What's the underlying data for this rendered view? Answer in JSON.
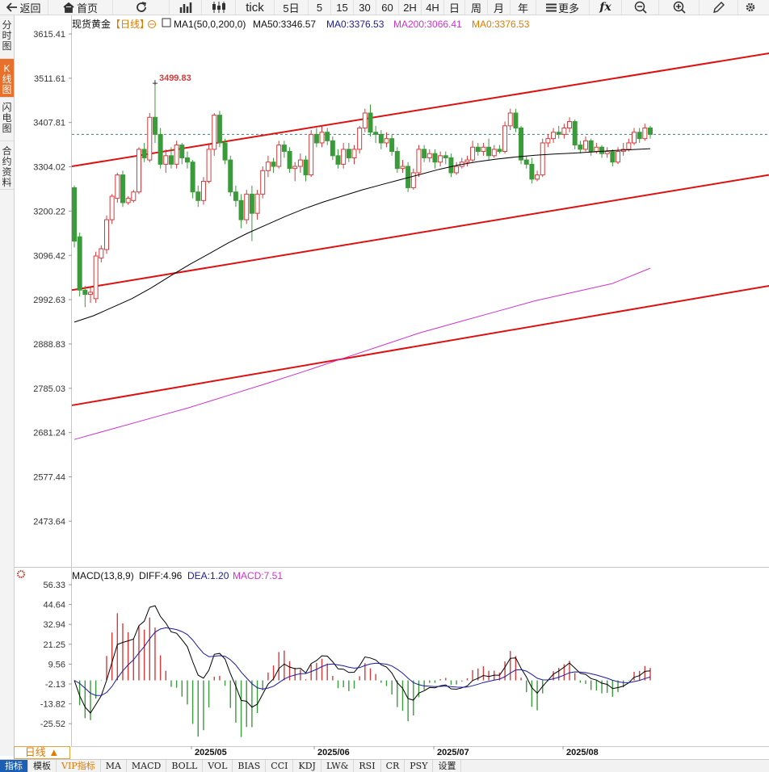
{
  "toolbar": {
    "back": "返回",
    "home": "首页",
    "tick": "tick",
    "periods": [
      "5日",
      "5",
      "15",
      "30",
      "60",
      "2H",
      "4H",
      "日",
      "周",
      "月",
      "年"
    ],
    "more": "更多"
  },
  "left_tabs": [
    {
      "label": "分时图",
      "active": false
    },
    {
      "label": "K线图",
      "active": true
    },
    {
      "label": "闪电图",
      "active": false
    },
    {
      "label": "合约资料",
      "active": false
    }
  ],
  "header": {
    "instrument": "现货黄金",
    "period": "【日线】",
    "ma1": "MA1(50,0,200,0)",
    "ma50": "MA50:3346.57",
    "ma0": "MA0:3376.53",
    "ma200": "MA200:3066.41",
    "ma0b": "MA0:3376.53"
  },
  "price_axis": [
    "3615.41",
    "3511.61",
    "3407.81",
    "3304.02",
    "3200.22",
    "3096.42",
    "2992.63",
    "2888.83",
    "2785.03",
    "2681.24",
    "2577.44",
    "2473.64"
  ],
  "high_label": "3499.83",
  "macd_header": {
    "name": "MACD(13,8,9)",
    "diff": "DIFF:4.96",
    "dea": "DEA:1.20",
    "macd": "MACD:7.51"
  },
  "macd_axis": [
    "56.33",
    "44.64",
    "32.94",
    "21.25",
    "9.56",
    "-2.13",
    "-13.82",
    "-25.52"
  ],
  "date_axis": [
    "2025/05",
    "2025/06",
    "2025/07",
    "2025/08"
  ],
  "period_tab": "日线 ▲",
  "bottom_tabs": [
    {
      "label": "指标",
      "active": true
    },
    {
      "label": "模板",
      "active": false
    },
    {
      "label": "VIP指标",
      "vip": true
    },
    {
      "label": "MA"
    },
    {
      "label": "MACD"
    },
    {
      "label": "BOLL"
    },
    {
      "label": "VOL"
    },
    {
      "label": "BIAS"
    },
    {
      "label": "CCI"
    },
    {
      "label": "KDJ"
    },
    {
      "label": "LW&"
    },
    {
      "label": "RSI"
    },
    {
      "label": "CR"
    },
    {
      "label": "PSY"
    },
    {
      "label": "设置"
    }
  ],
  "colors": {
    "up": "#d83a3a",
    "down": "#3a9b3a",
    "ma50": "#000000",
    "ma200": "#cc33cc",
    "channel": "#dd1111",
    "dea": "#1a1aa0"
  },
  "chart_data": {
    "type": "candlestick",
    "title": "现货黄金 日线",
    "ylim": [
      2420,
      3650
    ],
    "candles": [
      [
        3255,
        3130,
        3260,
        3115
      ],
      [
        3140,
        3015,
        3150,
        3000
      ],
      [
        3015,
        3005,
        3025,
        2975
      ],
      [
        3005,
        3010,
        3020,
        2985
      ],
      [
        2995,
        3095,
        3105,
        2985
      ],
      [
        3090,
        3112,
        3120,
        3080
      ],
      [
        3110,
        3180,
        3190,
        3100
      ],
      [
        3180,
        3235,
        3240,
        3170
      ],
      [
        3230,
        3285,
        3290,
        3220
      ],
      [
        3285,
        3220,
        3295,
        3210
      ],
      [
        3220,
        3230,
        3235,
        3215
      ],
      [
        3225,
        3245,
        3250,
        3220
      ],
      [
        3245,
        3345,
        3350,
        3240
      ],
      [
        3345,
        3325,
        3360,
        3315
      ],
      [
        3320,
        3420,
        3430,
        3315
      ],
      [
        3420,
        3380,
        3499.83,
        3360
      ],
      [
        3380,
        3310,
        3395,
        3300
      ],
      [
        3310,
        3330,
        3345,
        3290
      ],
      [
        3330,
        3310,
        3350,
        3300
      ],
      [
        3310,
        3355,
        3365,
        3300
      ],
      [
        3355,
        3325,
        3360,
        3310
      ],
      [
        3325,
        3315,
        3340,
        3300
      ],
      [
        3315,
        3245,
        3320,
        3230
      ],
      [
        3245,
        3225,
        3260,
        3210
      ],
      [
        3225,
        3270,
        3280,
        3215
      ],
      [
        3270,
        3345,
        3355,
        3265
      ],
      [
        3345,
        3425,
        3430,
        3330
      ],
      [
        3425,
        3360,
        3435,
        3350
      ],
      [
        3360,
        3320,
        3370,
        3310
      ],
      [
        3320,
        3245,
        3330,
        3235
      ],
      [
        3245,
        3225,
        3260,
        3210
      ],
      [
        3225,
        3180,
        3240,
        3160
      ],
      [
        3180,
        3240,
        3250,
        3170
      ],
      [
        3240,
        3195,
        3260,
        3130
      ],
      [
        3195,
        3240,
        3250,
        3180
      ],
      [
        3240,
        3295,
        3305,
        3230
      ],
      [
        3295,
        3315,
        3330,
        3280
      ],
      [
        3315,
        3305,
        3325,
        3290
      ],
      [
        3305,
        3355,
        3365,
        3300
      ],
      [
        3355,
        3340,
        3365,
        3325
      ],
      [
        3340,
        3300,
        3350,
        3290
      ],
      [
        3300,
        3305,
        3315,
        3270
      ],
      [
        3305,
        3320,
        3335,
        3290
      ],
      [
        3320,
        3285,
        3330,
        3270
      ],
      [
        3285,
        3380,
        3390,
        3280
      ],
      [
        3380,
        3360,
        3395,
        3350
      ],
      [
        3360,
        3385,
        3400,
        3350
      ],
      [
        3385,
        3365,
        3395,
        3355
      ],
      [
        3365,
        3330,
        3375,
        3320
      ],
      [
        3330,
        3310,
        3345,
        3300
      ],
      [
        3310,
        3345,
        3360,
        3300
      ],
      [
        3345,
        3325,
        3360,
        3315
      ],
      [
        3325,
        3345,
        3355,
        3310
      ],
      [
        3345,
        3395,
        3400,
        3335
      ],
      [
        3395,
        3430,
        3440,
        3385
      ],
      [
        3430,
        3385,
        3450,
        3375
      ],
      [
        3385,
        3380,
        3400,
        3360
      ],
      [
        3380,
        3360,
        3390,
        3345
      ],
      [
        3360,
        3370,
        3385,
        3350
      ],
      [
        3370,
        3340,
        3380,
        3330
      ],
      [
        3340,
        3300,
        3350,
        3290
      ],
      [
        3300,
        3305,
        3320,
        3290
      ],
      [
        3305,
        3255,
        3315,
        3245
      ],
      [
        3255,
        3290,
        3300,
        3250
      ],
      [
        3290,
        3345,
        3355,
        3280
      ],
      [
        3345,
        3325,
        3355,
        3315
      ],
      [
        3325,
        3335,
        3345,
        3315
      ],
      [
        3335,
        3315,
        3345,
        3300
      ],
      [
        3315,
        3330,
        3340,
        3305
      ],
      [
        3330,
        3325,
        3340,
        3310
      ],
      [
        3325,
        3290,
        3335,
        3280
      ],
      [
        3290,
        3305,
        3315,
        3285
      ],
      [
        3305,
        3315,
        3325,
        3300
      ],
      [
        3315,
        3320,
        3330,
        3305
      ],
      [
        3320,
        3350,
        3365,
        3315
      ],
      [
        3350,
        3340,
        3360,
        3330
      ],
      [
        3340,
        3350,
        3360,
        3330
      ],
      [
        3350,
        3330,
        3370,
        3320
      ],
      [
        3330,
        3345,
        3355,
        3325
      ],
      [
        3345,
        3340,
        3355,
        3335
      ],
      [
        3340,
        3400,
        3410,
        3335
      ],
      [
        3400,
        3430,
        3440,
        3390
      ],
      [
        3430,
        3395,
        3440,
        3385
      ],
      [
        3395,
        3320,
        3400,
        3310
      ],
      [
        3320,
        3310,
        3330,
        3300
      ],
      [
        3310,
        3275,
        3325,
        3265
      ],
      [
        3275,
        3285,
        3295,
        3270
      ],
      [
        3285,
        3360,
        3370,
        3280
      ],
      [
        3360,
        3370,
        3380,
        3350
      ],
      [
        3370,
        3385,
        3395,
        3360
      ],
      [
        3385,
        3380,
        3400,
        3370
      ],
      [
        3380,
        3395,
        3405,
        3370
      ],
      [
        3395,
        3410,
        3420,
        3385
      ],
      [
        3410,
        3355,
        3415,
        3345
      ],
      [
        3355,
        3345,
        3365,
        3335
      ],
      [
        3345,
        3365,
        3375,
        3340
      ],
      [
        3365,
        3340,
        3370,
        3330
      ],
      [
        3340,
        3350,
        3360,
        3335
      ],
      [
        3350,
        3335,
        3355,
        3325
      ],
      [
        3335,
        3340,
        3350,
        3325
      ],
      [
        3340,
        3315,
        3345,
        3305
      ],
      [
        3315,
        3340,
        3350,
        3310
      ],
      [
        3340,
        3345,
        3360,
        3330
      ],
      [
        3345,
        3360,
        3370,
        3340
      ],
      [
        3360,
        3385,
        3395,
        3355
      ],
      [
        3385,
        3370,
        3395,
        3360
      ],
      [
        3370,
        3395,
        3405,
        3365
      ],
      [
        3395,
        3380,
        3400,
        3370
      ]
    ],
    "ma50": [
      2940,
      2955,
      2975,
      2995,
      3020,
      3048,
      3075,
      3100,
      3125,
      3148,
      3168,
      3188,
      3206,
      3222,
      3236,
      3250,
      3262,
      3274,
      3286,
      3298,
      3308,
      3316,
      3322,
      3327,
      3331,
      3334,
      3336,
      3339,
      3342,
      3344,
      3346.57
    ],
    "ma200": [
      2665,
      2690,
      2715,
      2740,
      2768,
      2796,
      2825,
      2855,
      2885,
      2915,
      2940,
      2965,
      2990,
      3010,
      3030,
      3066.41
    ],
    "channel_lines": [
      {
        "from": [
          3305,
          null
        ],
        "to": [
          3570,
          null
        ]
      },
      {
        "from": [
          3015,
          null
        ],
        "to": [
          3285,
          null
        ]
      },
      {
        "from": [
          2745,
          null
        ],
        "to": [
          3025,
          null
        ]
      }
    ]
  }
}
